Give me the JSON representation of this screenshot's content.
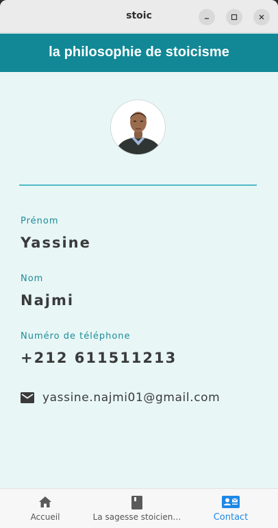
{
  "window": {
    "title": "stoic"
  },
  "appbar": {
    "title": "la philosophie de stoicisme"
  },
  "profile": {
    "first_name_label": "Prénom",
    "first_name": "Yassine",
    "last_name_label": "Nom",
    "last_name": "Najmi",
    "phone_label": "Numéro de téléphone",
    "phone": "+212 611511213",
    "email": "yassine.najmi01@gmail.com"
  },
  "nav": {
    "items": [
      {
        "label": "Accueil",
        "icon": "home-icon"
      },
      {
        "label": "La sagesse stoicien…",
        "icon": "book-icon"
      },
      {
        "label": "Contact",
        "icon": "contact-card-icon"
      }
    ],
    "active_color": "#1e88e5"
  },
  "colors": {
    "appbar": "#128896",
    "background": "#e8f6f6",
    "accent": "#1b8c97"
  }
}
